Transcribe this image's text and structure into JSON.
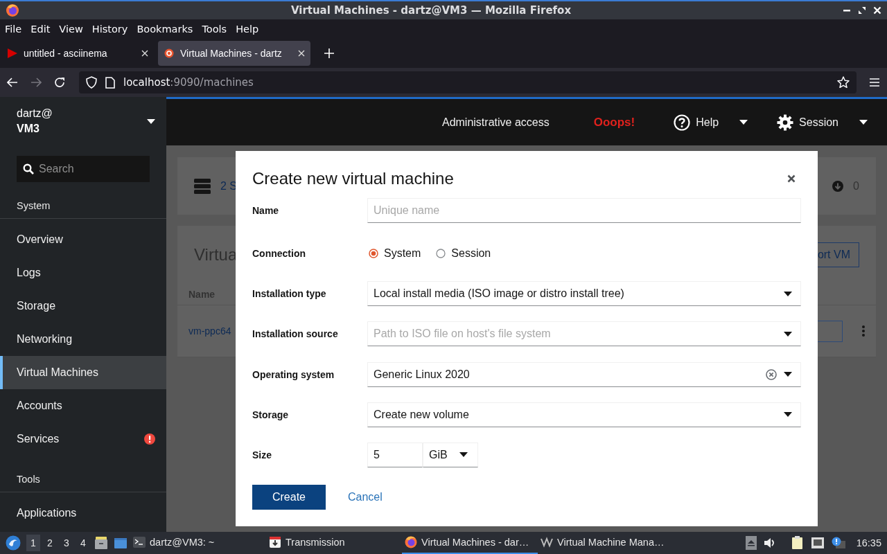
{
  "window": {
    "title": "Virtual Machines - dartz@VM3 — Mozilla Firefox"
  },
  "menu_bar": [
    {
      "label": "File"
    },
    {
      "label": "Edit"
    },
    {
      "label": "View"
    },
    {
      "label": "History"
    },
    {
      "label": "Bookmarks"
    },
    {
      "label": "Tools"
    },
    {
      "label": "Help"
    }
  ],
  "tabs": [
    {
      "title": "untitled - asciinema",
      "kind": "play",
      "selected": false
    },
    {
      "title": "Virtual Machines - dartz",
      "kind": "cockpit",
      "selected": true
    }
  ],
  "address": {
    "host": "localhost",
    "rest": ":9090/machines"
  },
  "sidebar": {
    "user": "dartz@",
    "host": "VM3",
    "search": {
      "placeholder": "Search"
    },
    "sections": [
      {
        "heading": "System",
        "items": [
          {
            "label": "Overview",
            "selected": false,
            "alert": false
          },
          {
            "label": "Logs",
            "selected": false,
            "alert": false
          },
          {
            "label": "Storage",
            "selected": false,
            "alert": false
          },
          {
            "label": "Networking",
            "selected": false,
            "alert": false
          },
          {
            "label": "Virtual Machines",
            "selected": true,
            "alert": false
          },
          {
            "label": "Accounts",
            "selected": false,
            "alert": false
          },
          {
            "label": "Services",
            "selected": false,
            "alert": true
          }
        ]
      },
      {
        "heading": "Tools",
        "items": [
          {
            "label": "Applications",
            "selected": false,
            "alert": false
          }
        ]
      }
    ]
  },
  "topbar": {
    "items": [
      {
        "kind": "text",
        "label": "Administrative access"
      },
      {
        "kind": "warning",
        "label": "Ooops!"
      },
      {
        "kind": "help",
        "label": "Help"
      },
      {
        "kind": "session",
        "label": "Session"
      }
    ]
  },
  "background": {
    "summary": "2 S",
    "downloads": "0",
    "card_title": "Virtua",
    "import_button": "ort VM",
    "column": "Name",
    "vm_link": "vm-ppc64"
  },
  "dialog": {
    "title": "Create new virtual machine",
    "fields": [
      {
        "kind": "text",
        "label": "Name",
        "placeholder": "Unique name"
      },
      {
        "kind": "radio",
        "label": "Connection",
        "options": [
          {
            "label": "System",
            "selected": true
          },
          {
            "label": "Session",
            "selected": false
          }
        ]
      },
      {
        "kind": "select",
        "label": "Installation type",
        "value": "Local install media (ISO image or distro install tree)"
      },
      {
        "kind": "select",
        "label": "Installation source",
        "placeholder": "Path to ISO file on host's file system"
      },
      {
        "kind": "select",
        "label": "Operating system",
        "value": "Generic Linux 2020",
        "clearable": true
      },
      {
        "kind": "select",
        "label": "Storage",
        "value": "Create new volume"
      },
      {
        "kind": "size",
        "label": "Size",
        "value": "5",
        "unit": "GiB"
      }
    ],
    "buttons": [
      {
        "label": "Create",
        "kind": "primary"
      },
      {
        "label": "Cancel",
        "kind": "link"
      }
    ]
  },
  "taskbar": {
    "workspaces": [
      {
        "label": "1",
        "selected": true
      },
      {
        "label": "2",
        "selected": false
      },
      {
        "label": "3",
        "selected": false
      },
      {
        "label": "4",
        "selected": false
      }
    ],
    "tasks": [
      {
        "label": "dartz@VM3: ~",
        "kind": "terminal",
        "selected": false
      },
      {
        "label": "Transmission",
        "kind": "transmission",
        "selected": false
      },
      {
        "label": "Virtual Machines - dar…",
        "kind": "firefox",
        "selected": true
      },
      {
        "label": "Virtual Machine Mana…",
        "kind": "virt",
        "selected": false
      }
    ],
    "clock": "16:35"
  }
}
